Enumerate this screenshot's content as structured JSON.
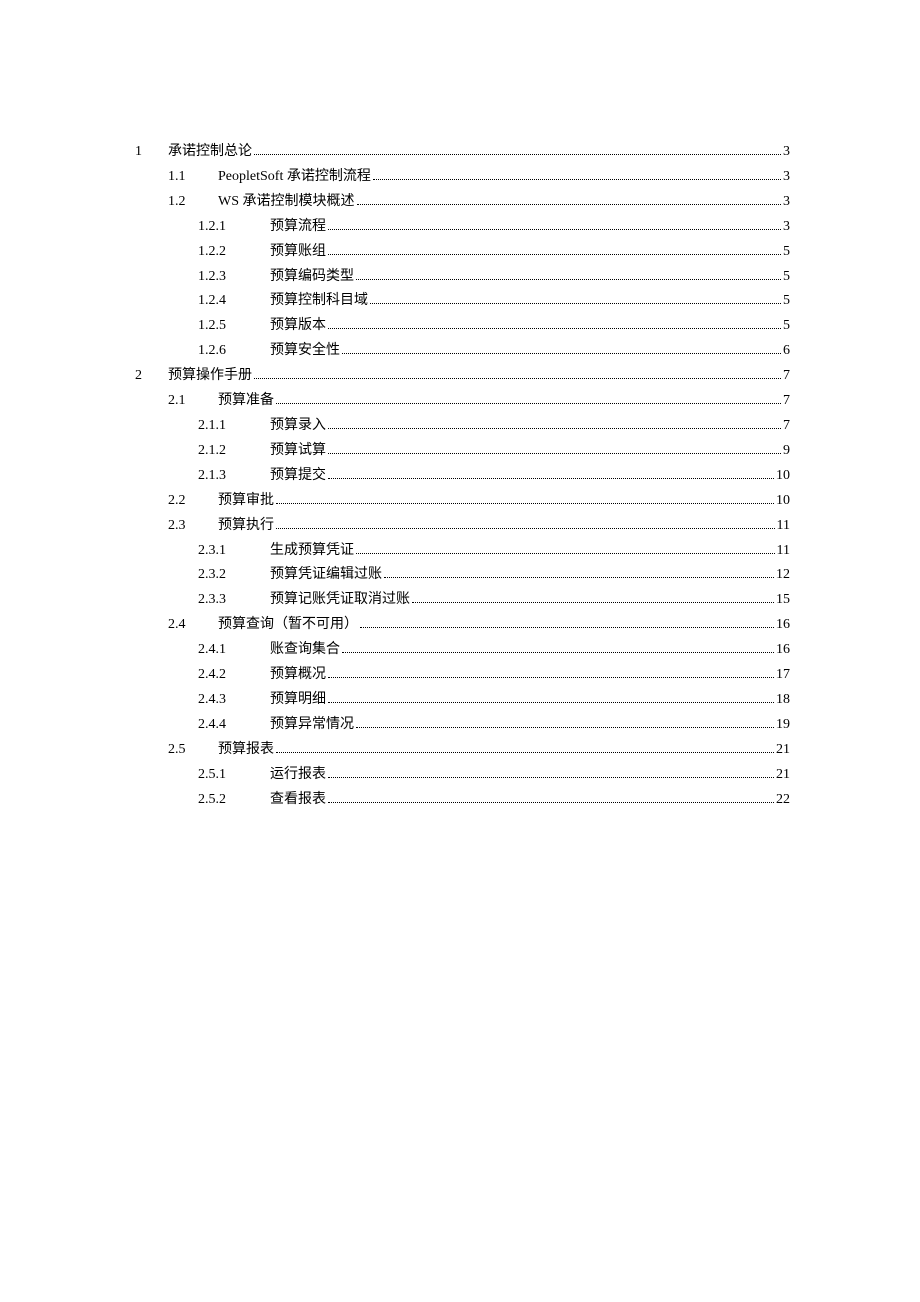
{
  "toc": [
    {
      "level": 1,
      "num": "1",
      "title": "承诺控制总论",
      "page": "3"
    },
    {
      "level": 2,
      "num": "1.1",
      "title": "PeopletSoft 承诺控制流程",
      "page": "3"
    },
    {
      "level": 2,
      "num": "1.2",
      "title": "WS 承诺控制模块概述",
      "page": "3"
    },
    {
      "level": 3,
      "num": "1.2.1",
      "title": "预算流程",
      "page": "3"
    },
    {
      "level": 3,
      "num": "1.2.2",
      "title": "预算账组",
      "page": "5"
    },
    {
      "level": 3,
      "num": "1.2.3",
      "title": "预算编码类型",
      "page": "5"
    },
    {
      "level": 3,
      "num": "1.2.4",
      "title": "预算控制科目域",
      "page": "5"
    },
    {
      "level": 3,
      "num": "1.2.5",
      "title": "预算版本",
      "page": "5"
    },
    {
      "level": 3,
      "num": "1.2.6",
      "title": "预算安全性",
      "page": "6"
    },
    {
      "level": 1,
      "num": "2",
      "title": "预算操作手册",
      "page": "7"
    },
    {
      "level": 2,
      "num": "2.1",
      "title": "预算准备",
      "page": "7"
    },
    {
      "level": 3,
      "num": "2.1.1",
      "title": "预算录入",
      "page": "7"
    },
    {
      "level": 3,
      "num": "2.1.2",
      "title": "预算试算",
      "page": "9"
    },
    {
      "level": 3,
      "num": "2.1.3",
      "title": "预算提交",
      "page": "10"
    },
    {
      "level": 2,
      "num": "2.2",
      "title": "预算审批",
      "page": "10"
    },
    {
      "level": 2,
      "num": "2.3",
      "title": "预算执行",
      "page": "11"
    },
    {
      "level": 3,
      "num": "2.3.1",
      "title": "生成预算凭证",
      "page": "11"
    },
    {
      "level": 3,
      "num": "2.3.2",
      "title": "预算凭证编辑过账",
      "page": "12"
    },
    {
      "level": 3,
      "num": "2.3.3",
      "title": "预算记账凭证取消过账",
      "page": "15"
    },
    {
      "level": 2,
      "num": "2.4",
      "title": "预算查询（暂不可用）",
      "page": "16"
    },
    {
      "level": 3,
      "num": "2.4.1",
      "title": "账查询集合",
      "page": "16"
    },
    {
      "level": 3,
      "num": "2.4.2",
      "title": "预算概况",
      "page": "17"
    },
    {
      "level": 3,
      "num": "2.4.3",
      "title": "预算明细",
      "page": "18"
    },
    {
      "level": 3,
      "num": "2.4.4",
      "title": "预算异常情况",
      "page": "19"
    },
    {
      "level": 2,
      "num": "2.5",
      "title": "预算报表",
      "page": "21"
    },
    {
      "level": 3,
      "num": "2.5.1",
      "title": "运行报表",
      "page": "21"
    },
    {
      "level": 3,
      "num": "2.5.2",
      "title": "查看报表",
      "page": "22"
    }
  ]
}
